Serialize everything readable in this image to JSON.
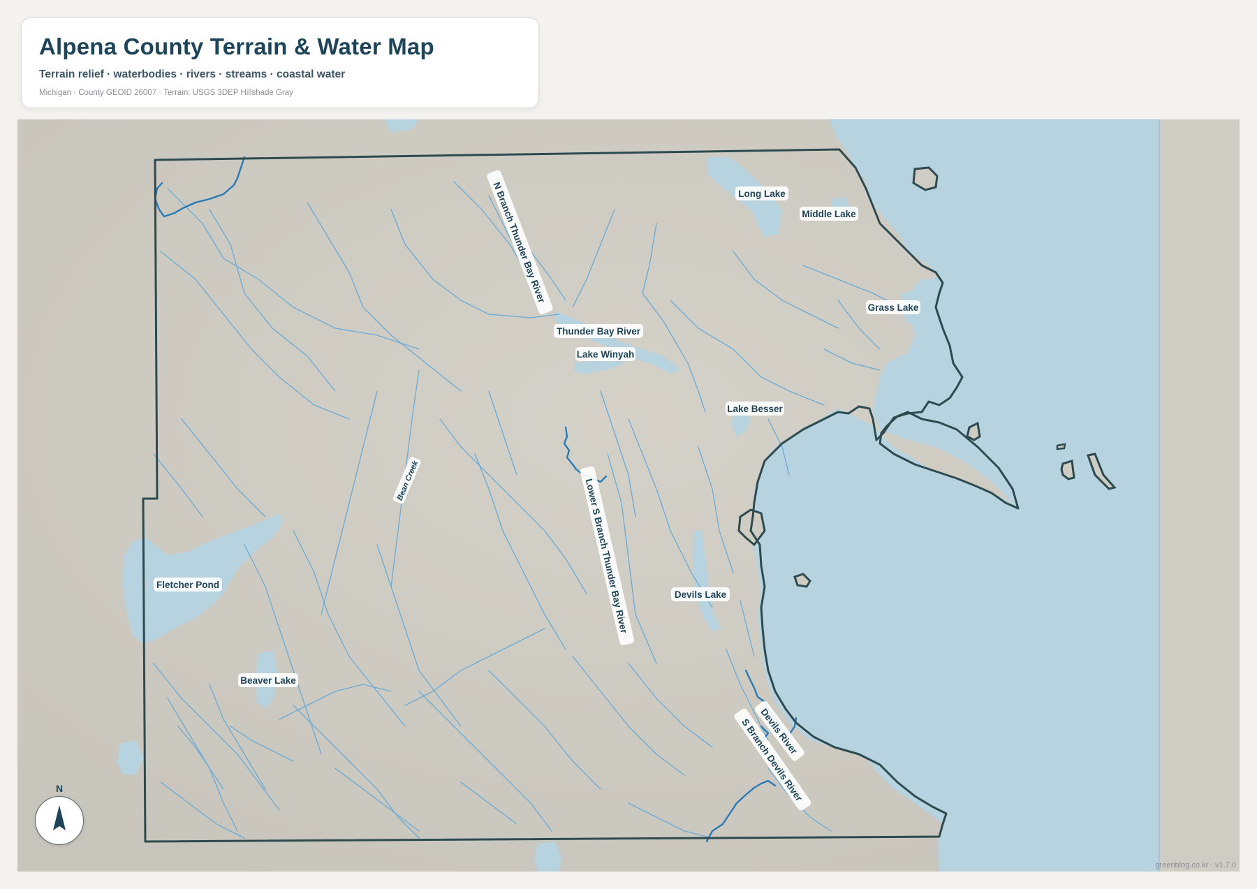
{
  "header": {
    "title": "Alpena County Terrain & Water Map",
    "subtitle": "Terrain relief · waterbodies · rivers · streams · coastal water",
    "meta": "Michigan · County GEOID 26007 · Terrain: USGS 3DEP Hillshade Gray"
  },
  "map": {
    "labels": {
      "long_lake": "Long Lake",
      "middle_lake": "Middle Lake",
      "grass_lake": "Grass Lake",
      "thunder_bay_river": "Thunder Bay River",
      "lake_winyah": "Lake Winyah",
      "lake_besser": "Lake Besser",
      "n_branch": "N Branch Thunder Bay River",
      "lower_s_branch": "Lower S Branch Thunder Bay River",
      "bean_creek": "Bean Creek",
      "fletcher_pond": "Fletcher Pond",
      "devils_lake": "Devils Lake",
      "beaver_lake": "Beaver Lake",
      "devils_river": "Devils River",
      "s_branch_devils": "S Branch Devils River"
    },
    "colors": {
      "water": "#b8d3e0",
      "river": "#2a7ab5",
      "stream": "#6aaad6",
      "land": "#cfccc3",
      "boundary": "#2d4a4f"
    }
  },
  "compass": {
    "letter": "N",
    "icon": "north-arrow-icon"
  },
  "credit": "greenblog.co.kr · v1.7.0"
}
